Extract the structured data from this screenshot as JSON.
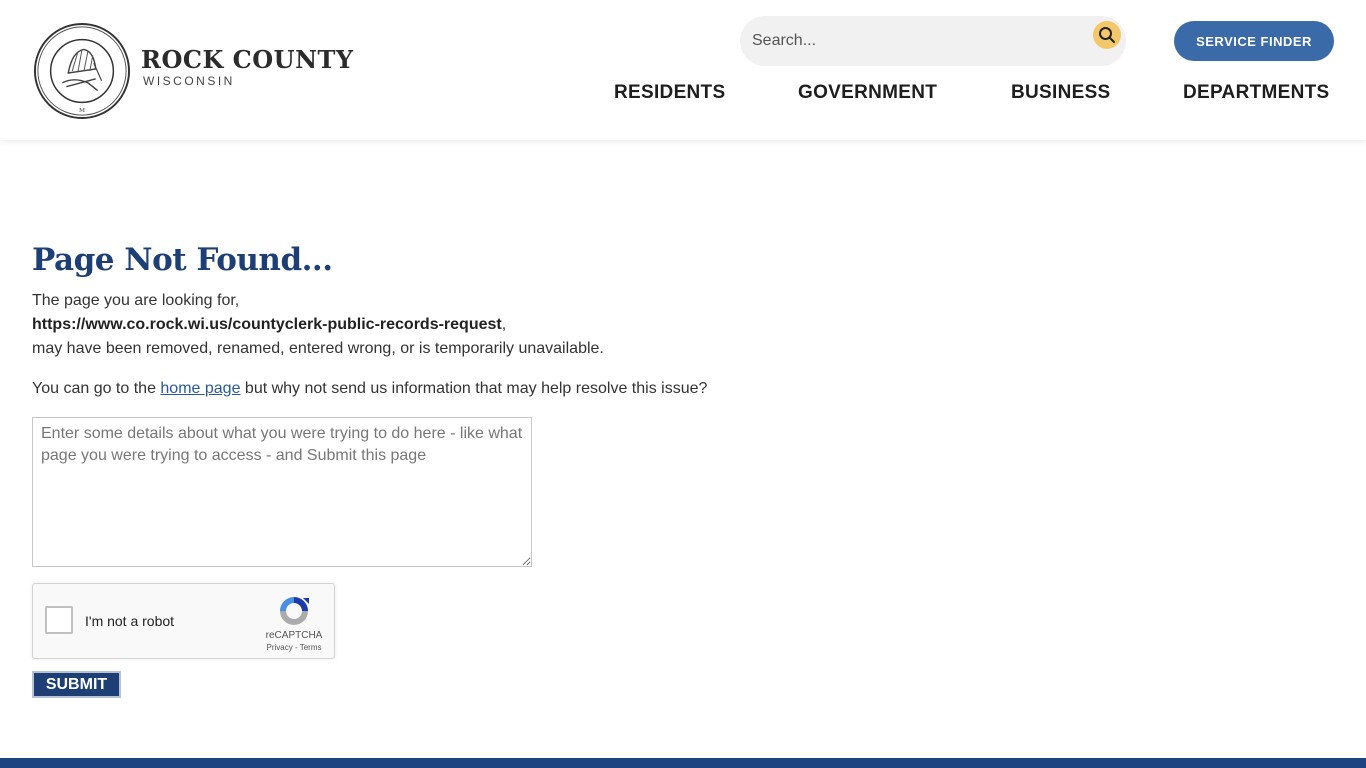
{
  "header": {
    "logo": {
      "title": "ROCK COUNTY",
      "subtitle": "WISCONSIN",
      "seal_icon": "county-seal-icon"
    },
    "search": {
      "placeholder": "Search...",
      "value": "",
      "icon": "search-icon",
      "accent_color": "#f3c86a"
    },
    "service_finder_label": "SERVICE FINDER",
    "nav": [
      {
        "label": "RESIDENTS"
      },
      {
        "label": "GOVERNMENT"
      },
      {
        "label": "BUSINESS"
      },
      {
        "label": "DEPARTMENTS"
      }
    ]
  },
  "main": {
    "title": "Page Not Found...",
    "intro": "The page you are looking for,",
    "url": "https://www.co.rock.wi.us/countyclerk-public-records-request",
    "url_suffix": ",",
    "explanation": "may have been removed, renamed, entered wrong, or is temporarily unavailable.",
    "help_prefix": "You can go to the ",
    "home_link_label": "home page",
    "help_suffix": " but why not send us information that may help resolve this issue?",
    "details_placeholder": "Enter some details about what you were trying to do here - like what page you were trying to access - and Submit this page",
    "details_value": "",
    "recaptcha": {
      "label": "I'm not a robot",
      "brand": "reCAPTCHA",
      "links": "Privacy - Terms",
      "checked": false
    },
    "submit_label": "SUBMIT"
  },
  "colors": {
    "brand_blue": "#1d3f76",
    "button_blue": "#3a6aa8",
    "footer_blue": "#1d4380",
    "search_accent": "#f3c86a"
  }
}
